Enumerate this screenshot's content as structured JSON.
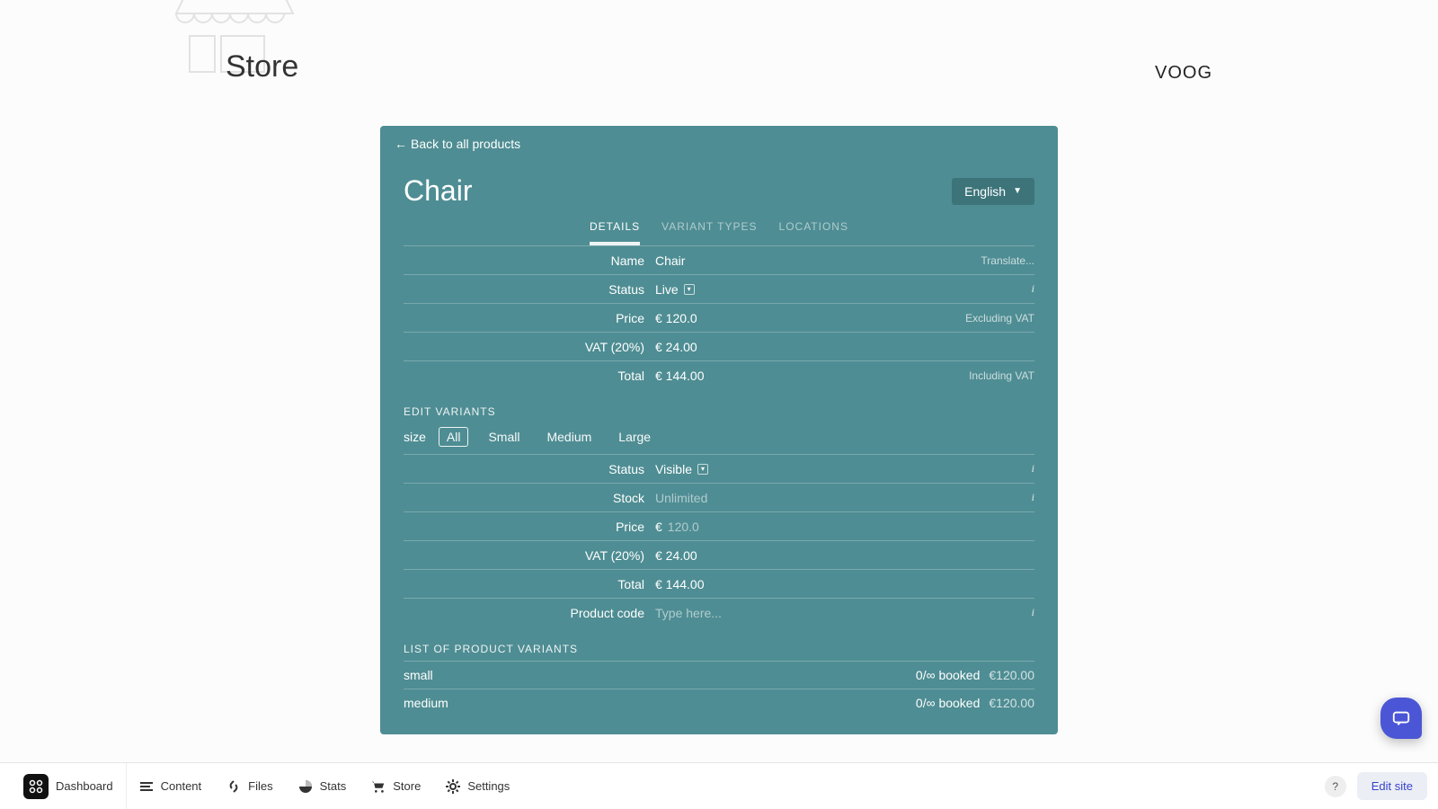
{
  "header": {
    "store_title": "Store",
    "brand": "VOOG"
  },
  "panel": {
    "back_label": "Back to all products",
    "product_title": "Chair",
    "language": "English"
  },
  "tabs": [
    {
      "label": "DETAILS",
      "active": true
    },
    {
      "label": "VARIANT TYPES",
      "active": false
    },
    {
      "label": "LOCATIONS",
      "active": false
    }
  ],
  "details": {
    "name_label": "Name",
    "name_value": "Chair",
    "name_aside": "Translate...",
    "status_label": "Status",
    "status_value": "Live",
    "price_label": "Price",
    "price_value": "€ 120.0",
    "price_aside": "Excluding VAT",
    "vat_label": "VAT (20%)",
    "vat_value": "€ 24.00",
    "total_label": "Total",
    "total_value": "€ 144.00",
    "total_aside": "Including VAT"
  },
  "variants_section": {
    "heading": "EDIT VARIANTS",
    "attr": "size",
    "options": [
      "All",
      "Small",
      "Medium",
      "Large"
    ],
    "active_index": 0
  },
  "variant_details": {
    "status_label": "Status",
    "status_value": "Visible",
    "stock_label": "Stock",
    "stock_placeholder": "Unlimited",
    "price_label": "Price",
    "price_currency": "€",
    "price_value": "120.0",
    "vat_label": "VAT (20%)",
    "vat_value": "€ 24.00",
    "total_label": "Total",
    "total_value": "€ 144.00",
    "code_label": "Product code",
    "code_placeholder": "Type here..."
  },
  "variant_list_heading": "LIST OF PRODUCT VARIANTS",
  "variant_list": [
    {
      "name": "small",
      "stock": "0/∞ booked",
      "price": "€120.00"
    },
    {
      "name": "medium",
      "stock": "0/∞ booked",
      "price": "€120.00"
    }
  ],
  "admin_bar": {
    "dashboard": "Dashboard",
    "content": "Content",
    "files": "Files",
    "stats": "Stats",
    "store": "Store",
    "settings": "Settings",
    "help": "?",
    "edit_site": "Edit site"
  }
}
